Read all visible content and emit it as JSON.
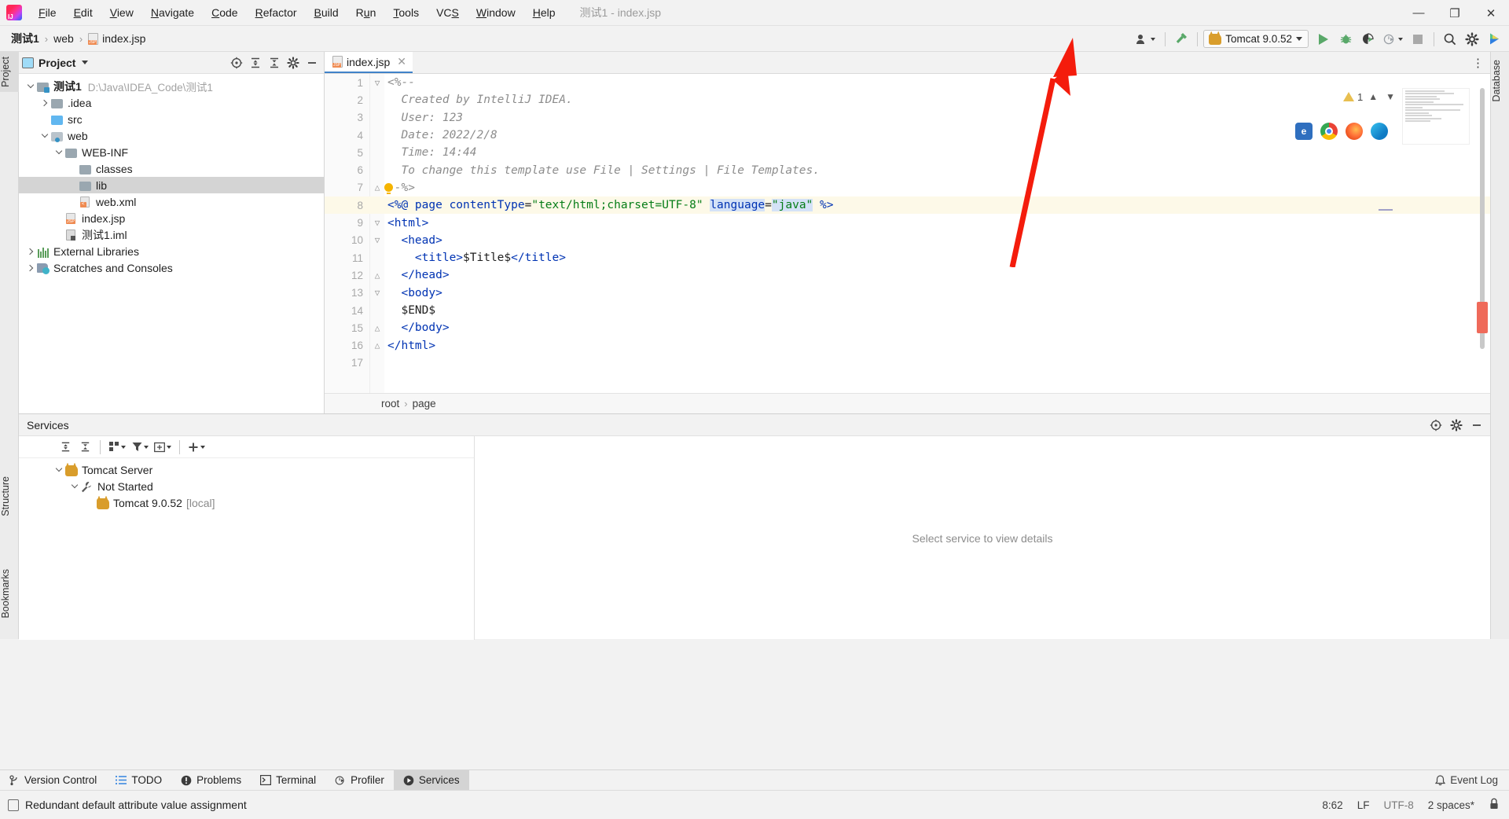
{
  "window": {
    "title": "测试1 - index.jsp",
    "minimize_label": "—",
    "maximize_label": "❐",
    "close_label": "✕"
  },
  "menubar": {
    "items": [
      {
        "name": "file",
        "label": "File",
        "mnemonic": "F"
      },
      {
        "name": "edit",
        "label": "Edit",
        "mnemonic": "E"
      },
      {
        "name": "view",
        "label": "View",
        "mnemonic": "V"
      },
      {
        "name": "navigate",
        "label": "Navigate",
        "mnemonic": "N"
      },
      {
        "name": "code",
        "label": "Code",
        "mnemonic": "C"
      },
      {
        "name": "refactor",
        "label": "Refactor",
        "mnemonic": "R"
      },
      {
        "name": "build",
        "label": "Build",
        "mnemonic": "B"
      },
      {
        "name": "run",
        "label": "Run",
        "mnemonic": "u"
      },
      {
        "name": "tools",
        "label": "Tools",
        "mnemonic": "T"
      },
      {
        "name": "vcs",
        "label": "VCS",
        "mnemonic": "S"
      },
      {
        "name": "window",
        "label": "Window",
        "mnemonic": "W"
      },
      {
        "name": "help",
        "label": "Help",
        "mnemonic": "H"
      }
    ]
  },
  "breadcrumb": {
    "items": [
      "测试1",
      "web",
      "index.jsp"
    ],
    "separator": "›"
  },
  "toolbar": {
    "run_config_label": "Tomcat 9.0.52",
    "run_title": "Run",
    "debug_title": "Debug",
    "run_coverage_title": "Run with Coverage",
    "profiler_title": "Profiler",
    "stop_title": "Stop",
    "search_title": "Search Everywhere",
    "settings_title": "Settings",
    "updates_title": "IDE and Plugin Updates"
  },
  "left_tool_tabs": [
    {
      "name": "project",
      "label": "Project",
      "selected": true
    },
    {
      "name": "structure",
      "label": "Structure",
      "selected": false
    },
    {
      "name": "bookmarks",
      "label": "Bookmarks",
      "selected": false
    }
  ],
  "right_tool_tabs": [
    {
      "name": "database",
      "label": "Database",
      "selected": false
    }
  ],
  "project_panel": {
    "title": "Project",
    "tree": [
      {
        "depth": 0,
        "label": "测试1",
        "path": "D:\\Java\\IDEA_Code\\测试1",
        "icon": "module-folder-icon",
        "expanded": true,
        "bold": true,
        "selected": false
      },
      {
        "depth": 1,
        "label": ".idea",
        "path": "",
        "icon": "folder-icon",
        "expanded": false,
        "bold": false,
        "selected": false
      },
      {
        "depth": 1,
        "label": "src",
        "path": "",
        "icon": "source-folder-icon",
        "expanded": null,
        "bold": false,
        "selected": false
      },
      {
        "depth": 1,
        "label": "web",
        "path": "",
        "icon": "web-root-icon",
        "expanded": true,
        "bold": false,
        "selected": false
      },
      {
        "depth": 2,
        "label": "WEB-INF",
        "path": "",
        "icon": "folder-icon",
        "expanded": true,
        "bold": false,
        "selected": false
      },
      {
        "depth": 3,
        "label": "classes",
        "path": "",
        "icon": "folder-icon",
        "expanded": null,
        "bold": false,
        "selected": false
      },
      {
        "depth": 3,
        "label": "lib",
        "path": "",
        "icon": "folder-icon",
        "expanded": null,
        "bold": false,
        "selected": true
      },
      {
        "depth": 3,
        "label": "web.xml",
        "path": "",
        "icon": "xml-file-icon",
        "expanded": null,
        "bold": false,
        "selected": false
      },
      {
        "depth": 2,
        "label": "index.jsp",
        "path": "",
        "icon": "jsp-file-icon",
        "expanded": null,
        "bold": false,
        "selected": false
      },
      {
        "depth": 2,
        "label": "测试1.iml",
        "path": "",
        "icon": "iml-file-icon",
        "expanded": null,
        "bold": false,
        "selected": false
      },
      {
        "depth": 0,
        "label": "External Libraries",
        "path": "",
        "icon": "library-icon",
        "expanded": false,
        "bold": false,
        "selected": false
      },
      {
        "depth": 0,
        "label": "Scratches and Consoles",
        "path": "",
        "icon": "scratch-icon",
        "expanded": false,
        "bold": false,
        "selected": false
      }
    ]
  },
  "editor": {
    "tab": {
      "label": "index.jsp",
      "icon": "jsp-file-icon",
      "close_label": "✕"
    },
    "warning_count": "1",
    "lines": [
      {
        "num": "1",
        "fold": "▽",
        "highlight": false,
        "segments": [
          {
            "cls": "cmt",
            "text": "<%--"
          }
        ]
      },
      {
        "num": "2",
        "fold": "",
        "highlight": false,
        "segments": [
          {
            "cls": "cmt",
            "text": "  Created by IntelliJ IDEA."
          }
        ]
      },
      {
        "num": "3",
        "fold": "",
        "highlight": false,
        "segments": [
          {
            "cls": "cmt",
            "text": "  User: 123"
          }
        ]
      },
      {
        "num": "4",
        "fold": "",
        "highlight": false,
        "segments": [
          {
            "cls": "cmt",
            "text": "  Date: 2022/2/8"
          }
        ]
      },
      {
        "num": "5",
        "fold": "",
        "highlight": false,
        "segments": [
          {
            "cls": "cmt",
            "text": "  Time: 14:44"
          }
        ]
      },
      {
        "num": "6",
        "fold": "",
        "highlight": false,
        "segments": [
          {
            "cls": "cmt",
            "text": "  To change this template use File | Settings | File Templates."
          }
        ]
      },
      {
        "num": "7",
        "fold": "△",
        "highlight": false,
        "segments": [
          {
            "cls": "cmt",
            "text": "--%>"
          }
        ]
      },
      {
        "num": "8",
        "fold": "",
        "highlight": true,
        "segments": [
          {
            "cls": "tag",
            "text": "<%@ "
          },
          {
            "cls": "kw",
            "text": "page"
          },
          {
            "cls": "plain",
            "text": " "
          },
          {
            "cls": "attr",
            "text": "contentType"
          },
          {
            "cls": "plain",
            "text": "="
          },
          {
            "cls": "str",
            "text": "\"text/html;charset=UTF-8\""
          },
          {
            "cls": "plain",
            "text": " "
          },
          {
            "cls": "attr lang-hl",
            "text": "language"
          },
          {
            "cls": "plain",
            "text": "="
          },
          {
            "cls": "str lang-hl",
            "text": "\"java\""
          },
          {
            "cls": "plain",
            "text": " "
          },
          {
            "cls": "tag",
            "text": "%>"
          }
        ]
      },
      {
        "num": "9",
        "fold": "▽",
        "highlight": false,
        "segments": [
          {
            "cls": "tag",
            "text": "<html>"
          }
        ]
      },
      {
        "num": "10",
        "fold": "▽",
        "highlight": false,
        "segments": [
          {
            "cls": "tag",
            "text": "  <head>"
          }
        ]
      },
      {
        "num": "11",
        "fold": "",
        "highlight": false,
        "segments": [
          {
            "cls": "tag",
            "text": "    <title>"
          },
          {
            "cls": "plain",
            "text": "$Title$"
          },
          {
            "cls": "tag",
            "text": "</title>"
          }
        ]
      },
      {
        "num": "12",
        "fold": "△",
        "highlight": false,
        "segments": [
          {
            "cls": "tag",
            "text": "  </head>"
          }
        ]
      },
      {
        "num": "13",
        "fold": "▽",
        "highlight": false,
        "segments": [
          {
            "cls": "tag",
            "text": "  <body>"
          }
        ]
      },
      {
        "num": "14",
        "fold": "",
        "highlight": false,
        "segments": [
          {
            "cls": "plain",
            "text": "  $END$"
          }
        ]
      },
      {
        "num": "15",
        "fold": "△",
        "highlight": false,
        "segments": [
          {
            "cls": "tag",
            "text": "  </body>"
          }
        ]
      },
      {
        "num": "16",
        "fold": "△",
        "highlight": false,
        "segments": [
          {
            "cls": "tag",
            "text": "</html>"
          }
        ]
      },
      {
        "num": "17",
        "fold": "",
        "highlight": false,
        "segments": []
      }
    ],
    "breadcrumbs": [
      "root",
      "page"
    ],
    "breadcrumb_separator": "›",
    "preview_browsers": [
      "ie-icon",
      "chrome-icon",
      "firefox-icon",
      "edge-icon"
    ]
  },
  "services": {
    "title": "Services",
    "tree": [
      {
        "depth": 0,
        "label": "Tomcat Server",
        "suffix": "",
        "icon": "tomcat-icon",
        "expanded": true
      },
      {
        "depth": 1,
        "label": "Not Started",
        "suffix": "",
        "icon": "wrench-icon",
        "expanded": true
      },
      {
        "depth": 2,
        "label": "Tomcat 9.0.52",
        "suffix": "[local]",
        "icon": "tomcat-icon",
        "expanded": null
      }
    ],
    "detail_placeholder": "Select service to view details",
    "toolbar_icons": [
      "expand-all-icon",
      "collapse-all-icon",
      "group-by-icon",
      "filter-icon",
      "add-tab-icon",
      "add-service-icon"
    ],
    "settings_title": "Settings",
    "hide_title": "Hide"
  },
  "bottom_tabs": [
    {
      "name": "version-control",
      "label": "Version Control",
      "icon": "branch-icon",
      "selected": false
    },
    {
      "name": "todo",
      "label": "TODO",
      "icon": "list-icon",
      "selected": false
    },
    {
      "name": "problems",
      "label": "Problems",
      "icon": "warning-icon",
      "selected": false
    },
    {
      "name": "terminal",
      "label": "Terminal",
      "icon": "terminal-icon",
      "selected": false
    },
    {
      "name": "profiler",
      "label": "Profiler",
      "icon": "profiler-icon",
      "selected": false
    },
    {
      "name": "services",
      "label": "Services",
      "icon": "services-icon",
      "selected": true
    }
  ],
  "event_log": {
    "label": "Event Log",
    "icon": "bell-icon"
  },
  "statusbar": {
    "message": "Redundant default attribute value assignment",
    "caret_position": "8:62",
    "line_separator": "LF",
    "encoding": "UTF-8",
    "indent": "2 spaces*",
    "lock_icon": "lock-icon"
  }
}
